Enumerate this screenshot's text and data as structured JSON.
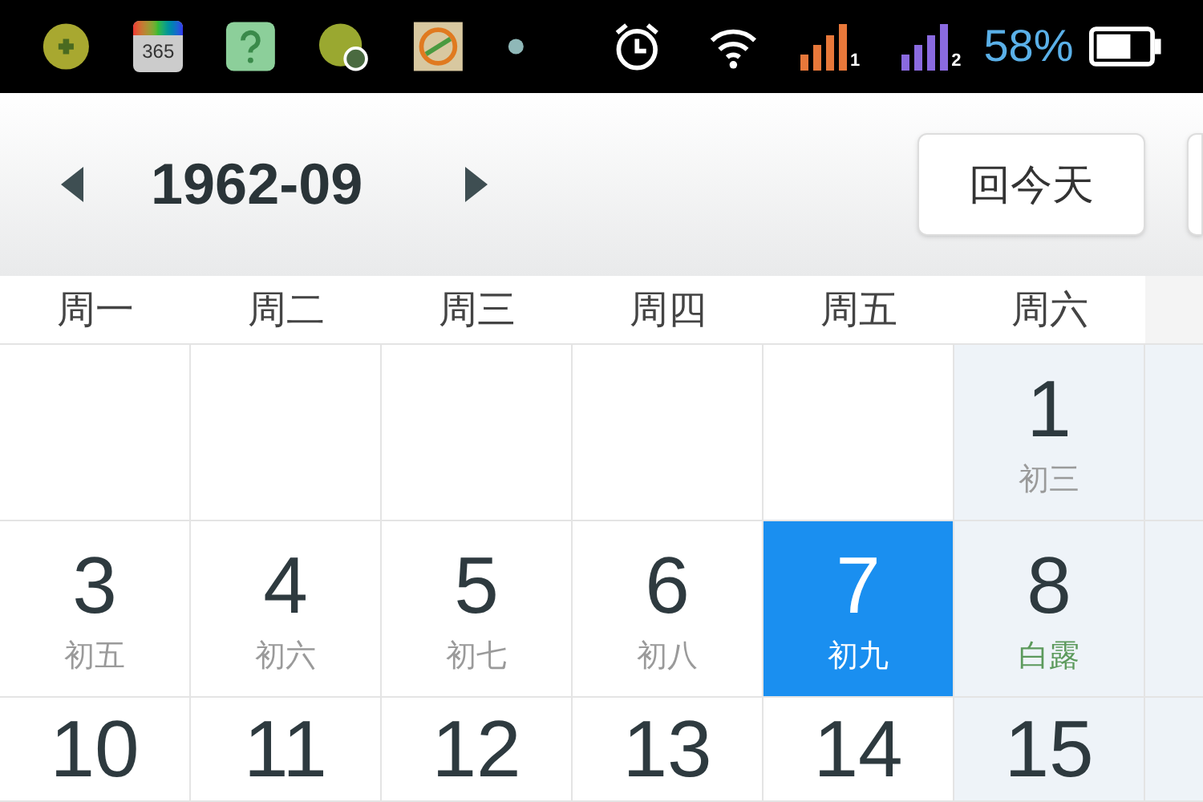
{
  "status_bar": {
    "calendar_badge": "365",
    "sim_1": "1",
    "sim_2": "2",
    "battery": "58%"
  },
  "header": {
    "month": "1962-09",
    "today_button": "回今天"
  },
  "weekdays": [
    "周一",
    "周二",
    "周三",
    "周四",
    "周五",
    "周六"
  ],
  "weeks": [
    [
      {
        "kind": "empty",
        "weekend": false
      },
      {
        "kind": "empty",
        "weekend": false
      },
      {
        "kind": "empty",
        "weekend": false
      },
      {
        "kind": "empty",
        "weekend": false
      },
      {
        "kind": "empty",
        "weekend": false
      },
      {
        "kind": "normal",
        "day": "1",
        "lunar": "初三",
        "weekend": true,
        "selected": false
      }
    ],
    [
      {
        "kind": "normal",
        "day": "3",
        "lunar": "初五",
        "weekend": false,
        "selected": false
      },
      {
        "kind": "normal",
        "day": "4",
        "lunar": "初六",
        "weekend": false,
        "selected": false
      },
      {
        "kind": "normal",
        "day": "5",
        "lunar": "初七",
        "weekend": false,
        "selected": false
      },
      {
        "kind": "normal",
        "day": "6",
        "lunar": "初八",
        "weekend": false,
        "selected": false
      },
      {
        "kind": "normal",
        "day": "7",
        "lunar": "初九",
        "weekend": false,
        "selected": true
      },
      {
        "kind": "term",
        "day": "8",
        "lunar": "白露",
        "weekend": true,
        "selected": false
      }
    ],
    [
      {
        "kind": "normal",
        "day": "10",
        "weekend": false,
        "selected": false
      },
      {
        "kind": "normal",
        "day": "11",
        "weekend": false,
        "selected": false
      },
      {
        "kind": "normal",
        "day": "12",
        "weekend": false,
        "selected": false
      },
      {
        "kind": "normal",
        "day": "13",
        "weekend": false,
        "selected": false
      },
      {
        "kind": "normal",
        "day": "14",
        "weekend": false,
        "selected": false
      },
      {
        "kind": "normal",
        "day": "15",
        "weekend": true,
        "selected": false
      }
    ]
  ]
}
